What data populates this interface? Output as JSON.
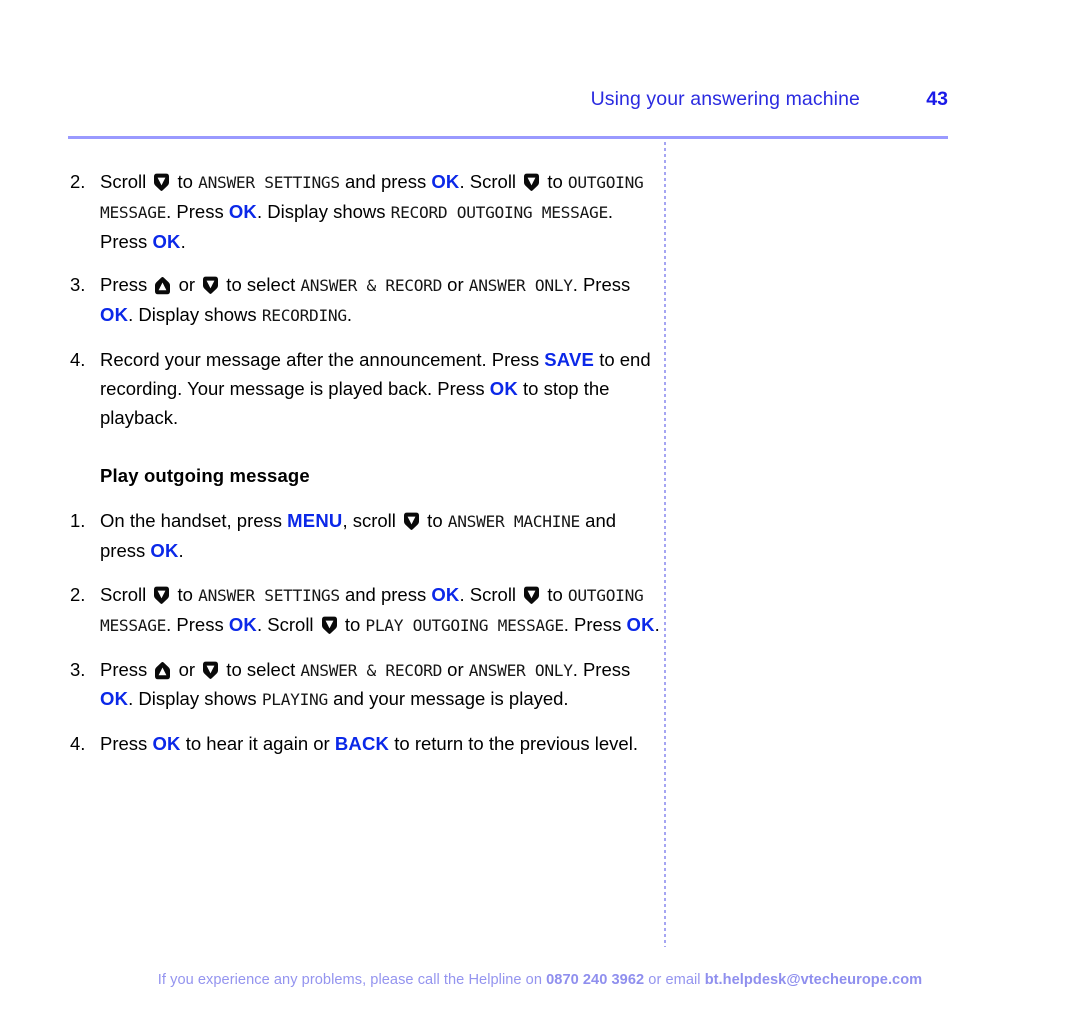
{
  "header": {
    "title": "Using your answering machine",
    "page_number": "43",
    "title_color": "#2b2be0",
    "rule_color": "#9a9aff"
  },
  "divider": {
    "style": "dotted-vertical",
    "color": "#a5a5f2"
  },
  "colors": {
    "key_blue": "#0b28e8",
    "header_blue": "#2b2be0",
    "footer_periwinkle": "#9494ef",
    "body_black": "#000000"
  },
  "icons": {
    "scroll_down": "arrow-down-icon",
    "scroll_up": "arrow-up-icon"
  },
  "sections": [
    {
      "heading": null,
      "steps": [
        {
          "number": "2.",
          "parts": [
            {
              "t": "text",
              "v": "Scroll "
            },
            {
              "t": "icon",
              "v": "arrow-down-icon"
            },
            {
              "t": "text",
              "v": " to "
            },
            {
              "t": "lcd",
              "v": "ANSWER SETTINGS"
            },
            {
              "t": "text",
              "v": " and press "
            },
            {
              "t": "key",
              "v": "OK"
            },
            {
              "t": "text",
              "v": ". Scroll "
            },
            {
              "t": "icon",
              "v": "arrow-down-icon"
            },
            {
              "t": "text",
              "v": " to "
            },
            {
              "t": "lcd",
              "v": "OUTGOING MESSAGE"
            },
            {
              "t": "text",
              "v": ". Press "
            },
            {
              "t": "key",
              "v": "OK"
            },
            {
              "t": "text",
              "v": ". Display shows "
            },
            {
              "t": "lcd",
              "v": "RECORD OUTGOING MESSAGE"
            },
            {
              "t": "text",
              "v": ". Press "
            },
            {
              "t": "key",
              "v": "OK"
            },
            {
              "t": "text",
              "v": "."
            }
          ]
        },
        {
          "number": "3.",
          "parts": [
            {
              "t": "text",
              "v": "Press "
            },
            {
              "t": "icon",
              "v": "arrow-up-icon"
            },
            {
              "t": "text",
              "v": " or "
            },
            {
              "t": "icon",
              "v": "arrow-down-icon"
            },
            {
              "t": "text",
              "v": " to select "
            },
            {
              "t": "lcd",
              "v": "ANSWER & RECORD"
            },
            {
              "t": "text",
              "v": " or "
            },
            {
              "t": "lcd",
              "v": "ANSWER ONLY"
            },
            {
              "t": "text",
              "v": ". Press "
            },
            {
              "t": "key",
              "v": "OK"
            },
            {
              "t": "text",
              "v": ". Display shows "
            },
            {
              "t": "lcd",
              "v": "RECORDING"
            },
            {
              "t": "text",
              "v": "."
            }
          ]
        },
        {
          "number": "4.",
          "parts": [
            {
              "t": "text",
              "v": "Record your message after the announcement. Press "
            },
            {
              "t": "key",
              "v": "SAVE"
            },
            {
              "t": "text",
              "v": " to end recording. Your message is played back. Press "
            },
            {
              "t": "key",
              "v": "OK"
            },
            {
              "t": "text",
              "v": " to stop the playback."
            }
          ]
        }
      ]
    },
    {
      "heading": "Play outgoing message",
      "steps": [
        {
          "number": "1.",
          "parts": [
            {
              "t": "text",
              "v": "On the handset, press "
            },
            {
              "t": "key",
              "v": "MENU"
            },
            {
              "t": "text",
              "v": ", scroll "
            },
            {
              "t": "icon",
              "v": "arrow-down-icon"
            },
            {
              "t": "text",
              "v": " to "
            },
            {
              "t": "lcd",
              "v": "ANSWER MACHINE"
            },
            {
              "t": "text",
              "v": " and press "
            },
            {
              "t": "key",
              "v": "OK"
            },
            {
              "t": "text",
              "v": "."
            }
          ]
        },
        {
          "number": "2.",
          "parts": [
            {
              "t": "text",
              "v": "Scroll "
            },
            {
              "t": "icon",
              "v": "arrow-down-icon"
            },
            {
              "t": "text",
              "v": " to "
            },
            {
              "t": "lcd",
              "v": "ANSWER SETTINGS"
            },
            {
              "t": "text",
              "v": " and press "
            },
            {
              "t": "key",
              "v": "OK"
            },
            {
              "t": "text",
              "v": ". Scroll "
            },
            {
              "t": "icon",
              "v": "arrow-down-icon"
            },
            {
              "t": "text",
              "v": " to "
            },
            {
              "t": "lcd",
              "v": "OUTGOING MESSAGE"
            },
            {
              "t": "text",
              "v": ". Press "
            },
            {
              "t": "key",
              "v": "OK"
            },
            {
              "t": "text",
              "v": ". Scroll "
            },
            {
              "t": "icon",
              "v": "arrow-down-icon"
            },
            {
              "t": "text",
              "v": " to "
            },
            {
              "t": "lcd",
              "v": "PLAY OUTGOING MESSAGE"
            },
            {
              "t": "text",
              "v": ". Press "
            },
            {
              "t": "key",
              "v": "OK"
            },
            {
              "t": "text",
              "v": "."
            }
          ]
        },
        {
          "number": "3.",
          "parts": [
            {
              "t": "text",
              "v": "Press "
            },
            {
              "t": "icon",
              "v": "arrow-up-icon"
            },
            {
              "t": "text",
              "v": " or "
            },
            {
              "t": "icon",
              "v": "arrow-down-icon"
            },
            {
              "t": "text",
              "v": " to select "
            },
            {
              "t": "lcd",
              "v": "ANSWER & RECORD"
            },
            {
              "t": "text",
              "v": " or "
            },
            {
              "t": "lcd",
              "v": "ANSWER ONLY"
            },
            {
              "t": "text",
              "v": ". Press "
            },
            {
              "t": "key",
              "v": "OK"
            },
            {
              "t": "text",
              "v": ". Display shows "
            },
            {
              "t": "lcd",
              "v": "PLAYING"
            },
            {
              "t": "text",
              "v": " and your message is played."
            }
          ]
        },
        {
          "number": "4.",
          "parts": [
            {
              "t": "text",
              "v": "Press "
            },
            {
              "t": "key",
              "v": "OK"
            },
            {
              "t": "text",
              "v": " to hear it again or "
            },
            {
              "t": "key",
              "v": "BACK"
            },
            {
              "t": "text",
              "v": " to return to the previous level."
            }
          ]
        }
      ]
    }
  ],
  "footer": {
    "lead": "If you experience any problems, please call the Helpline on ",
    "phone": "0870 240 3962",
    "middle": " or email ",
    "email": "bt.helpdesk@vtecheurope.com"
  }
}
